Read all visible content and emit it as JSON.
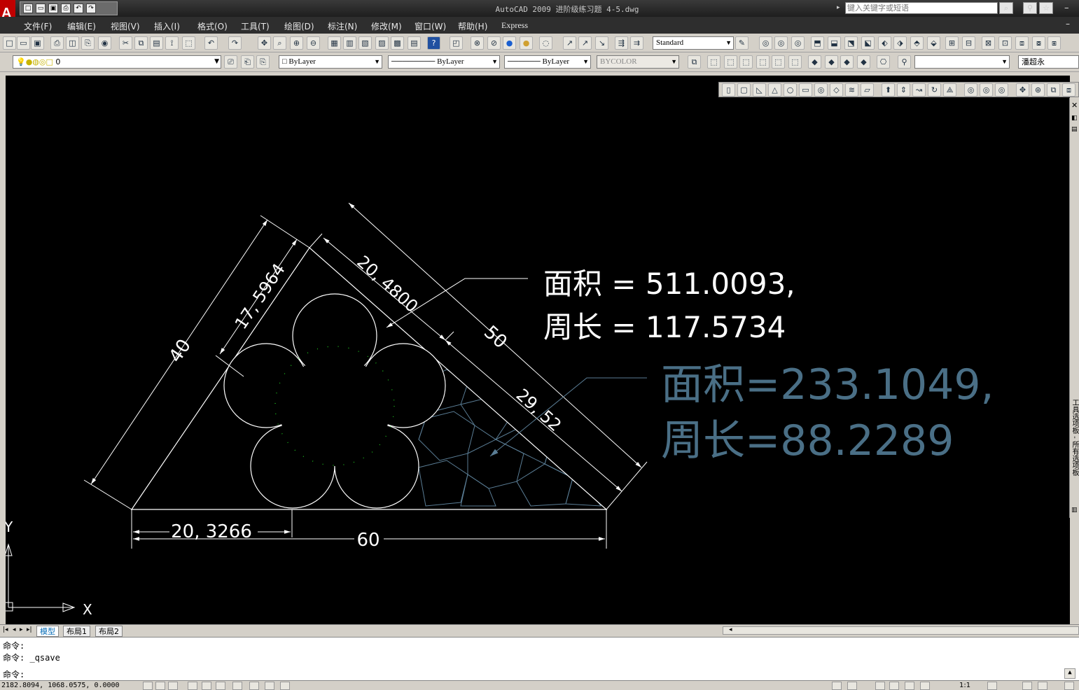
{
  "window": {
    "title": "AutoCAD 2009 进阶级练习题 4-5.dwg",
    "search_placeholder": "键入关键字或短语",
    "logo": "A"
  },
  "menu": [
    "文件(F)",
    "编辑(E)",
    "视图(V)",
    "插入(I)",
    "格式(O)",
    "工具(T)",
    "绘图(D)",
    "标注(N)",
    "修改(M)",
    "窗口(W)",
    "帮助(H)",
    "Express"
  ],
  "toolbar": {
    "text_style": "Standard",
    "layer": "0",
    "color": "ByLayer",
    "linetype": "ByLayer",
    "lineweight": "ByLayer",
    "plotstyle": "BYCOLOR",
    "user": "潘超永"
  },
  "palette_label": "工具选项板 - 所有选项板",
  "drawing": {
    "dim_left": "40",
    "dim_left_inner": "17, 5964",
    "dim_right": "50",
    "dim_right_inner_top": "20, 4800",
    "dim_right_inner_bottom": "29, 52",
    "dim_bottom": "60",
    "dim_bottom_inner": "20, 3266",
    "note1_line1": "面积 = 511.0093,",
    "note1_line2": "周长 = 117.5734",
    "note2_line1": "面积=233.1049,",
    "note2_line2": "周长=88.2289",
    "ucs_x": "X",
    "ucs_y": "Y",
    "colors": {
      "line": "#ffffff",
      "note2": "#4a6f86",
      "hatch": "#5a7d95",
      "dots": "#1fd11f"
    }
  },
  "tabs": [
    "模型",
    "布局1",
    "布局2"
  ],
  "command": {
    "line1": "命令:",
    "line2": "命令: _qsave",
    "prompt": "命令:"
  },
  "status": {
    "coords": "2182.8094, 1068.0575, 0.0000",
    "scale": "1:1"
  }
}
